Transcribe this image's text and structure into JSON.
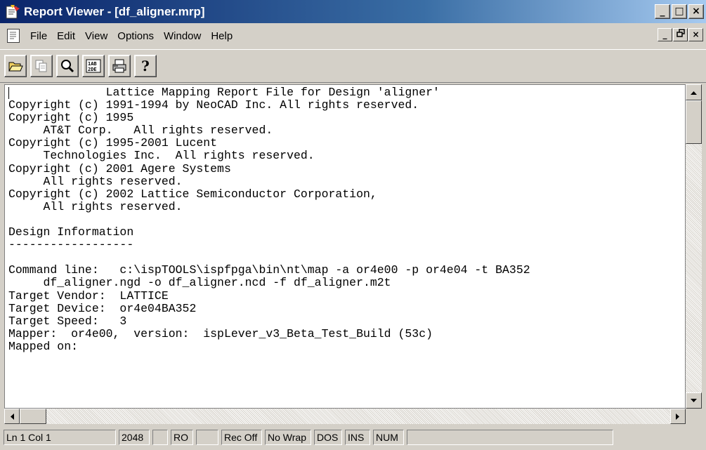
{
  "window": {
    "title": "Report Viewer - [df_aligner.mrp]",
    "controls": {
      "minimize": "_",
      "maximize": "□",
      "close": "×"
    }
  },
  "menu": {
    "items": [
      "File",
      "Edit",
      "View",
      "Options",
      "Window",
      "Help"
    ]
  },
  "toolbar": {
    "buttons": [
      "open-folder",
      "copy",
      "find",
      "sort",
      "print",
      "help"
    ],
    "help_glyph": "?"
  },
  "report": {
    "text": "              Lattice Mapping Report File for Design 'aligner'\nCopyright (c) 1991-1994 by NeoCAD Inc. All rights reserved.\nCopyright (c) 1995\n     AT&T Corp.   All rights reserved.\nCopyright (c) 1995-2001 Lucent\n     Technologies Inc.  All rights reserved.\nCopyright (c) 2001 Agere Systems\n     All rights reserved.\nCopyright (c) 2002 Lattice Semiconductor Corporation,\n     All rights reserved.\n\nDesign Information\n------------------\n\nCommand line:   c:\\ispTOOLS\\ispfpga\\bin\\nt\\map -a or4e00 -p or4e04 -t BA352\n     df_aligner.ngd -o df_aligner.ncd -f df_aligner.m2t\nTarget Vendor:  LATTICE\nTarget Device:  or4e04BA352\nTarget Speed:   3\nMapper:  or4e00,  version:  ispLever_v3_Beta_Test_Build (53c)\nMapped on:"
  },
  "status": {
    "position": "Ln 1 Col 1",
    "size": "2048",
    "empty1": "",
    "readonly": "RO",
    "empty2": "",
    "record": "Rec Off",
    "wrap": "No Wrap",
    "format": "DOS",
    "insert": "INS",
    "numlock": "NUM",
    "empty3": ""
  },
  "colors": {
    "title_gradient_start": "#0a246a",
    "title_gradient_end": "#a6caf0",
    "chrome": "#d4d0c8"
  }
}
